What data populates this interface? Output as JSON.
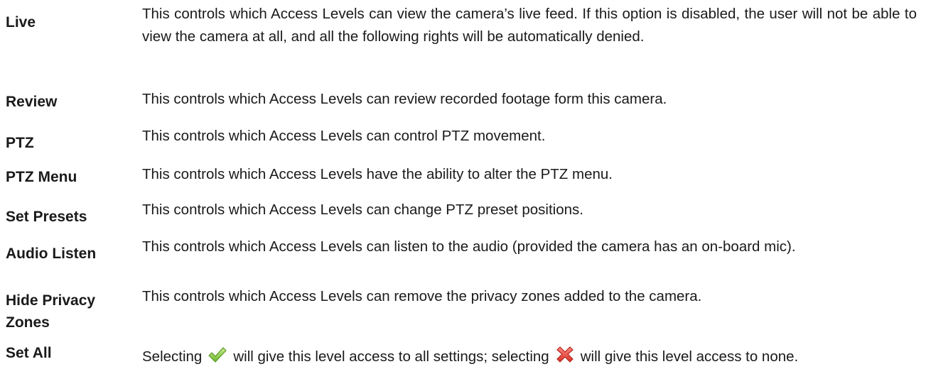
{
  "rows": [
    {
      "term": "Live",
      "description": "This controls which Access Levels can view the camera’s live feed. If this option is disabled, the user will not be able to view the camera at all, and all the following rights will be automatically denied."
    },
    {
      "term": "Review",
      "description": "This controls which Access Levels can review recorded footage form this camera."
    },
    {
      "term": "PTZ",
      "description": "This controls which Access Levels can control PTZ movement."
    },
    {
      "term": "PTZ Menu",
      "description": "This controls which Access Levels have the ability to alter the PTZ menu."
    },
    {
      "term": "Set Presets",
      "description": "This controls which Access Levels can change PTZ preset positions."
    },
    {
      "term": "Audio Listen",
      "description": "This controls which Access Levels can listen to the audio (provided the camera has an on-board mic)."
    },
    {
      "term": "Hide Privacy Zones",
      "description": "This controls which Access Levels can remove the privacy zones added to the camera."
    },
    {
      "term": "Set All",
      "description_part1": "Selecting",
      "description_part2": "will give this level access to all settings; selecting",
      "description_part3": "will give this level access to none."
    }
  ],
  "icons": {
    "check": "green-check-icon",
    "cross": "red-x-icon",
    "check_color": "#7dc242",
    "cross_color": "#e04a3f"
  }
}
